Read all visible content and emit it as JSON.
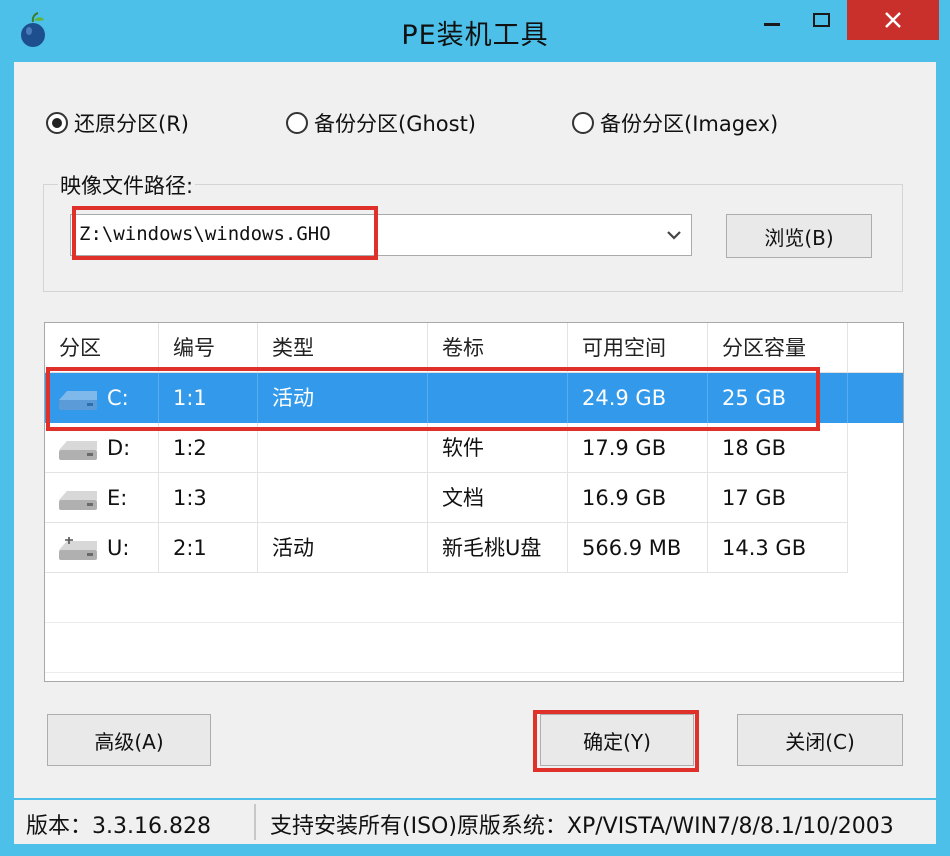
{
  "window": {
    "title": "PE装机工具"
  },
  "modes": [
    {
      "label": "还原分区(R)",
      "checked": true
    },
    {
      "label": "备份分区(Ghost)",
      "checked": false
    },
    {
      "label": "备份分区(Imagex)",
      "checked": false
    }
  ],
  "image_path": {
    "label": "映像文件路径:",
    "value": "Z:\\windows\\windows.GHO",
    "browse_label": "浏览(B)"
  },
  "table": {
    "columns": [
      "分区",
      "编号",
      "类型",
      "卷标",
      "可用空间",
      "分区容量"
    ],
    "rows": [
      {
        "drive": "C:",
        "number": "1:1",
        "type": "活动",
        "label": "",
        "free": "24.9 GB",
        "capacity": "25 GB",
        "icon": "hard-drive-icon",
        "selected": true
      },
      {
        "drive": "D:",
        "number": "1:2",
        "type": "",
        "label": "软件",
        "free": "17.9 GB",
        "capacity": "18 GB",
        "icon": "hard-drive-icon",
        "selected": false
      },
      {
        "drive": "E:",
        "number": "1:3",
        "type": "",
        "label": "文档",
        "free": "16.9 GB",
        "capacity": "17 GB",
        "icon": "hard-drive-icon",
        "selected": false
      },
      {
        "drive": "U:",
        "number": "2:1",
        "type": "活动",
        "label": "新毛桃U盘",
        "free": "566.9 MB",
        "capacity": "14.3 GB",
        "icon": "usb-drive-icon",
        "selected": false
      }
    ]
  },
  "buttons": {
    "advanced": "高级(A)",
    "ok": "确定(Y)",
    "close": "关闭(C)"
  },
  "status": {
    "version": "版本：3.3.16.828",
    "systems": "支持安装所有(ISO)原版系统：XP/VISTA/WIN7/8/8.1/10/2003"
  },
  "colors": {
    "titlebar": "#4cc0e8",
    "selection": "#3399ea",
    "highlight": "#e0302a",
    "close_button": "#c9302c"
  }
}
